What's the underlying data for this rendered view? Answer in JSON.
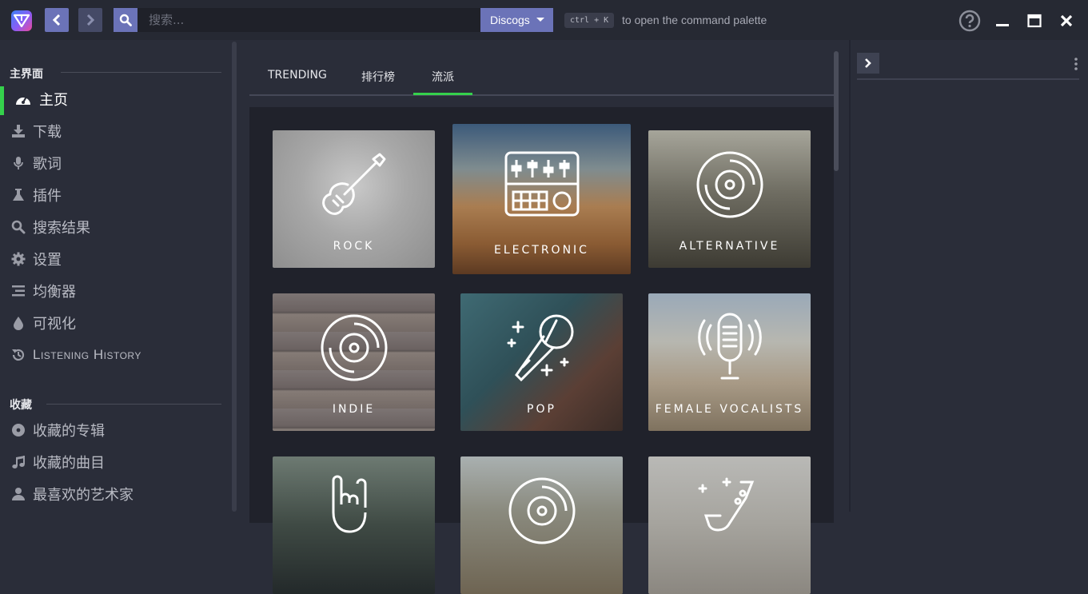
{
  "topbar": {
    "search_placeholder": "搜索...",
    "provider": "Discogs",
    "shortcut": "ctrl + K",
    "shortcut_hint": "to open the command palette"
  },
  "sidebar": {
    "main_section": "主界面",
    "items": [
      {
        "label": "主页",
        "icon": "dashboard-icon"
      },
      {
        "label": "下载",
        "icon": "download-icon"
      },
      {
        "label": "歌词",
        "icon": "microphone-icon"
      },
      {
        "label": "插件",
        "icon": "flask-icon"
      },
      {
        "label": "搜索结果",
        "icon": "search-icon"
      },
      {
        "label": "设置",
        "icon": "gear-icon"
      },
      {
        "label": "均衡器",
        "icon": "equalizer-icon"
      },
      {
        "label": "可视化",
        "icon": "drop-icon"
      },
      {
        "label": "Listening History",
        "icon": "history-icon"
      }
    ],
    "favorites_section": "收藏",
    "favorites": [
      {
        "label": "收藏的专辑",
        "icon": "disc-icon"
      },
      {
        "label": "收藏的曲目",
        "icon": "music-note-icon"
      },
      {
        "label": "最喜欢的艺术家",
        "icon": "user-icon"
      }
    ]
  },
  "tabs": [
    "TRENDING",
    "排行榜",
    "流派"
  ],
  "active_tab": "流派",
  "genres": [
    {
      "label": "ROCK",
      "icon": "guitar-icon"
    },
    {
      "label": "ELECTRONIC",
      "icon": "synth-icon"
    },
    {
      "label": "ALTERNATIVE",
      "icon": "vinyl-icon"
    },
    {
      "label": "INDIE",
      "icon": "vinyl-icon"
    },
    {
      "label": "POP",
      "icon": "microphone-icon"
    },
    {
      "label": "FEMALE VOCALISTS",
      "icon": "studio-mic-icon"
    },
    {
      "label": "",
      "icon": "rock-hand-icon"
    },
    {
      "label": "",
      "icon": "vinyl-icon"
    },
    {
      "label": "",
      "icon": "saxophone-icon"
    }
  ],
  "colors": {
    "accent_green": "#35d14c",
    "button_purple": "#6b73b8",
    "background": "#2a2d39",
    "content_bg": "#20222b"
  }
}
